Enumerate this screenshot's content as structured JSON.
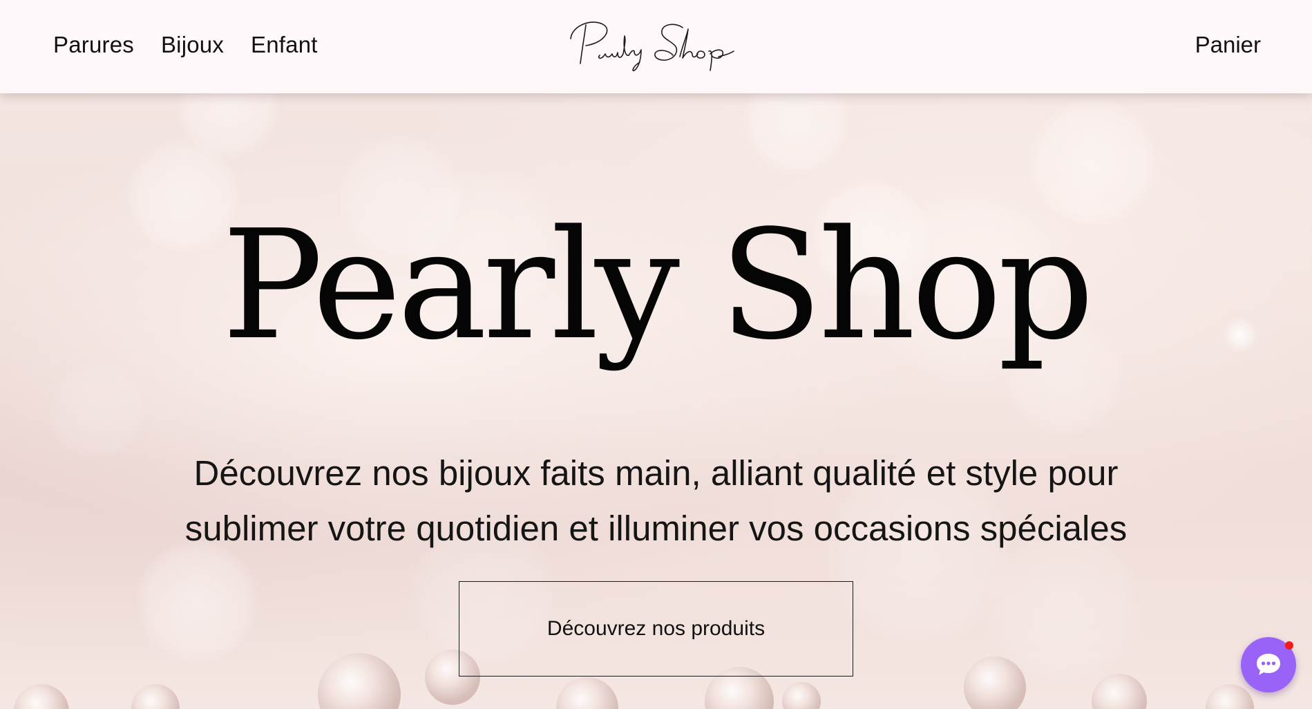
{
  "header": {
    "nav": [
      {
        "label": "Parures"
      },
      {
        "label": "Bijoux"
      },
      {
        "label": "Enfant"
      }
    ],
    "logo_text": "Pearly Shop",
    "cart_label": "Panier"
  },
  "hero": {
    "title": "Pearly Shop",
    "subtitle": "Découvrez nos bijoux faits main, alliant qualité et style pour sublimer votre quotidien et illuminer vos occasions spéciales",
    "cta_label": "Découvrez nos produits"
  },
  "chat": {
    "icon": "chat-bubble-icon",
    "notification": true
  },
  "colors": {
    "header_bg": "#fff7f9",
    "hero_bg": "#f3e4e0",
    "text": "#111111",
    "chat_accent": "#9a63f7",
    "notification": "#f21b1b"
  }
}
